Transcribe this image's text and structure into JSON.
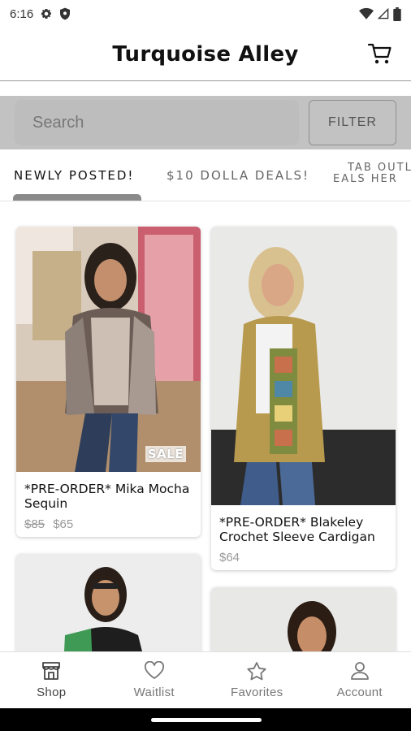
{
  "status_bar": {
    "time": "6:16"
  },
  "header": {
    "title": "Turquoise Alley"
  },
  "search": {
    "placeholder": "Search",
    "filter_label": "FILTER"
  },
  "tabs": [
    {
      "label": "NEWLY POSTED!",
      "active": true
    },
    {
      "label": "$10 DOLLA DEALS!",
      "active": false
    },
    {
      "label_line1": "TAB OUTL",
      "label_line2": "EALS HER",
      "active": false
    }
  ],
  "products": [
    {
      "name": "*PRE-ORDER* Mika Mocha Sequin",
      "old_price": "$85",
      "price": "$65",
      "badge": "SALE"
    },
    {
      "name": "*PRE-ORDER* Blakeley Crochet Sleeve Cardigan",
      "price": "$64"
    }
  ],
  "bottom_nav": [
    {
      "label": "Shop",
      "icon": "shop-icon",
      "active": true
    },
    {
      "label": "Waitlist",
      "icon": "heart-icon",
      "active": false
    },
    {
      "label": "Favorites",
      "icon": "star-icon",
      "active": false
    },
    {
      "label": "Account",
      "icon": "person-icon",
      "active": false
    }
  ]
}
